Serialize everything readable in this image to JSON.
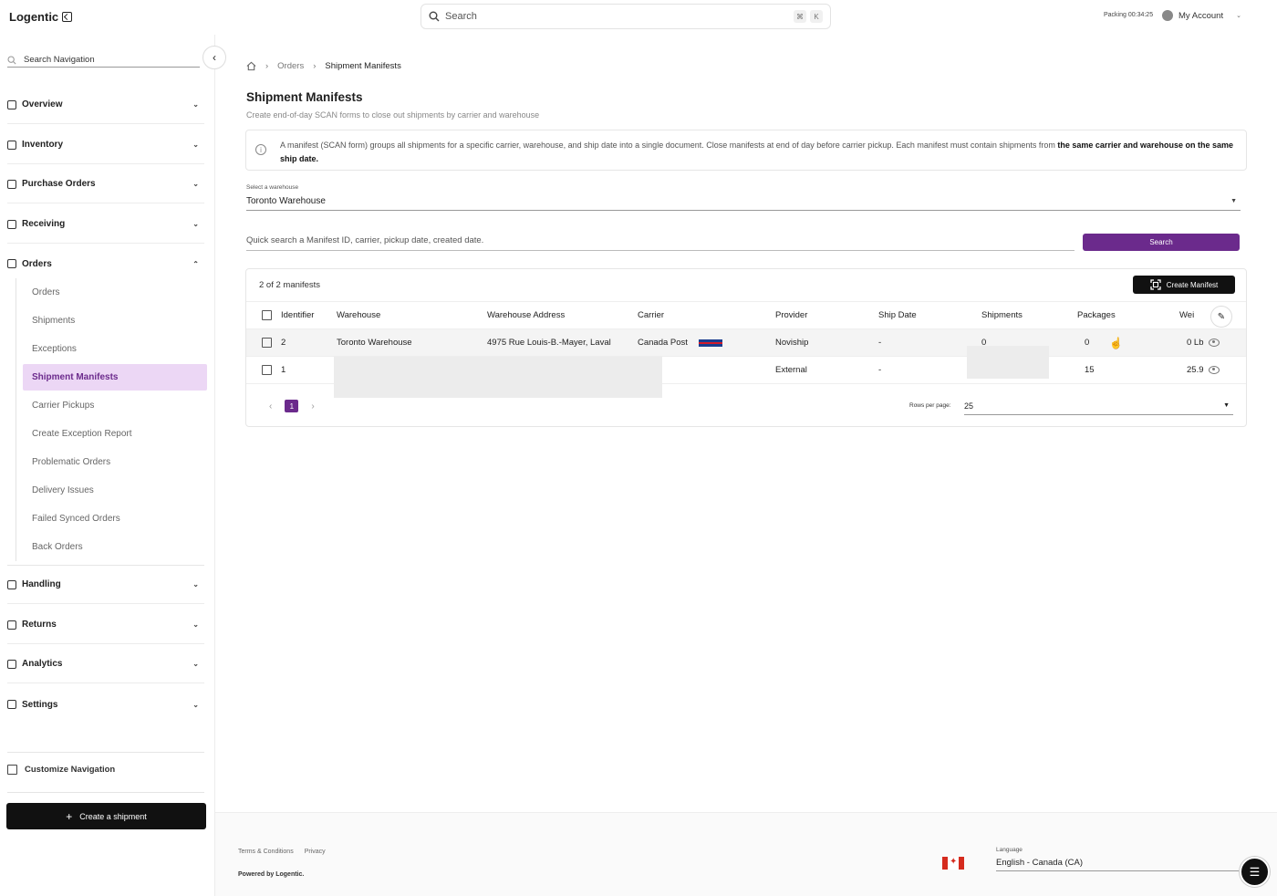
{
  "app": {
    "logo": "Logentic"
  },
  "topbar": {
    "search_placeholder": "Search",
    "kbd_cmd": "⌘",
    "kbd_k": "K",
    "packing_timer": "Packing 00:34:25",
    "account_label": "My Account"
  },
  "sidebar": {
    "search_placeholder": "Search Navigation",
    "sections": [
      {
        "label": "Overview",
        "icon": "home-icon"
      },
      {
        "label": "Inventory",
        "icon": "cube-icon"
      },
      {
        "label": "Purchase Orders",
        "icon": "cart-icon"
      },
      {
        "label": "Receiving",
        "icon": "receive-icon"
      },
      {
        "label": "Orders",
        "icon": "document-icon"
      },
      {
        "label": "Handling",
        "icon": "hand-icon"
      },
      {
        "label": "Returns",
        "icon": "return-icon"
      },
      {
        "label": "Analytics",
        "icon": "bar-chart-icon"
      },
      {
        "label": "Settings",
        "icon": "gear-icon"
      }
    ],
    "orders_items": [
      "Orders",
      "Shipments",
      "Exceptions",
      "Shipment Manifests",
      "Carrier Pickups",
      "Create Exception Report",
      "Problematic Orders",
      "Delivery Issues",
      "Failed Synced Orders",
      "Back Orders"
    ],
    "active_item": "Shipment Manifests",
    "customize_label": "Customize Navigation",
    "create_shipment_label": "Create a shipment"
  },
  "breadcrumb": {
    "level1": "Orders",
    "current": "Shipment Manifests"
  },
  "page": {
    "title": "Shipment Manifests",
    "subtitle": "Create end-of-day SCAN forms to close out shipments by carrier and warehouse",
    "info_text": "A manifest (SCAN form) groups all shipments for a specific carrier, warehouse, and ship date into a single document. Close manifests at end of day before carrier pickup. Each manifest must contain shipments from ",
    "info_bold_1": "the same carrier and warehouse",
    "info_bold_2": "on the same ship date."
  },
  "warehouse_select": {
    "label": "Select a warehouse",
    "value": "Toronto Warehouse"
  },
  "quick_search": {
    "placeholder": "Quick search a Manifest ID, carrier, pickup date, created date.",
    "button": "Search"
  },
  "table": {
    "count_text": "2 of 2 manifests",
    "create_button": "Create Manifest",
    "columns": [
      "Identifier",
      "Warehouse",
      "Warehouse Address",
      "Carrier",
      "Provider",
      "Ship Date",
      "Shipments",
      "Packages",
      "Wei"
    ],
    "rows": [
      {
        "identifier": "2",
        "warehouse": "Toronto Warehouse",
        "address": "4975 Rue Louis-B.-Mayer, Laval",
        "carrier": "Canada Post",
        "provider": "Noviship",
        "ship_date": "-",
        "shipments": "0",
        "packages": "0",
        "weight": "0 Lb"
      },
      {
        "identifier": "1",
        "warehouse": "",
        "address": "",
        "carrier": "",
        "provider": "External",
        "ship_date": "-",
        "shipments": "",
        "packages": "15",
        "weight": "25.9"
      }
    ],
    "page_current": "1",
    "rows_per_page_label": "Rows per page:",
    "rows_per_page_value": "25"
  },
  "footer": {
    "terms": "Terms & Conditions",
    "privacy": "Privacy",
    "powered": "Powered by Logentic.",
    "language_label": "Language",
    "language_value": "English - Canada (CA)"
  },
  "colors": {
    "accent": "#6b2a8c",
    "active_bg": "#ecd7f5",
    "dark": "#111111"
  }
}
